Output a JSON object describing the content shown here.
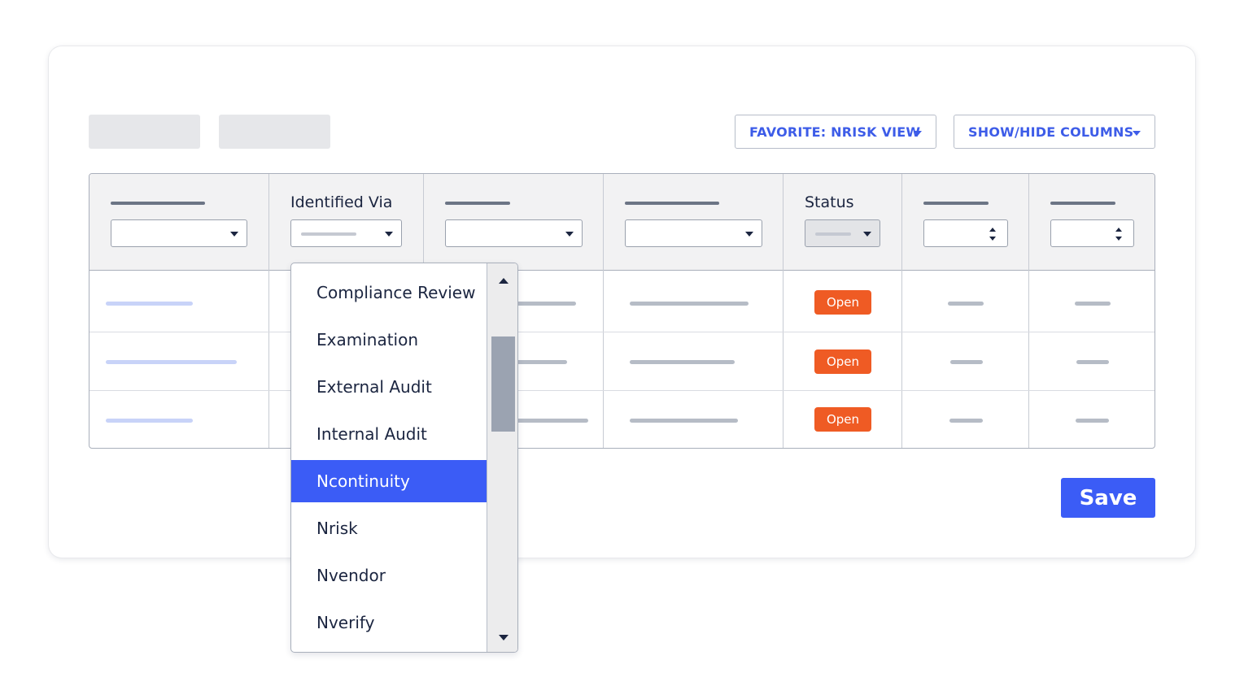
{
  "toolbar": {
    "favorite_label": "FAVORITE: NRISK VIEW",
    "columns_label": "SHOW/HIDE COLUMNS"
  },
  "table": {
    "headers": {
      "identified_via": "Identified Via",
      "status": "Status"
    },
    "rows": [
      {
        "status": "Open"
      },
      {
        "status": "Open"
      },
      {
        "status": "Open"
      }
    ]
  },
  "dropdown": {
    "options": [
      "Compliance Review",
      "Examination",
      "External Audit",
      "Internal Audit",
      "Ncontinuity",
      "Nrisk",
      "Nvendor",
      "Nverify"
    ],
    "selected": "Ncontinuity"
  },
  "actions": {
    "save_label": "Save"
  },
  "colors": {
    "accent": "#3b5cf6",
    "status_open": "#ef5b24"
  },
  "icons": {
    "dropdown_caret": "chevron-down-icon",
    "spinner": "sort-arrows-icon",
    "scroll_up": "scroll-up-icon",
    "scroll_down": "scroll-down-icon"
  }
}
